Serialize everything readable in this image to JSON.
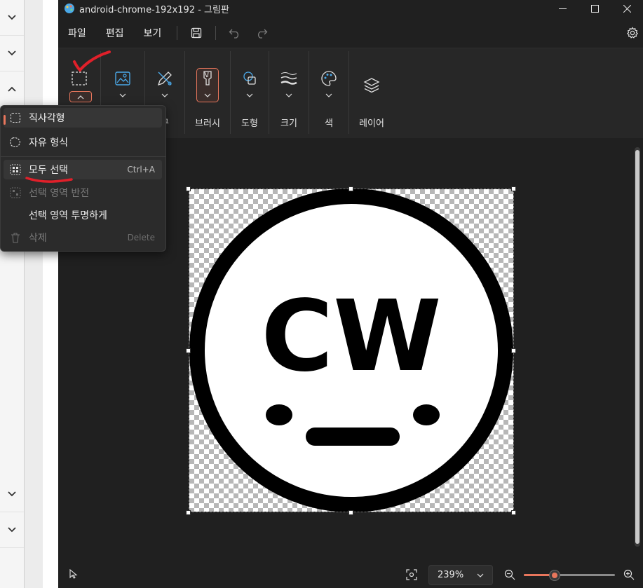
{
  "window": {
    "title": "android-chrome-192x192 - 그림판"
  },
  "menu": {
    "file": "파일",
    "edit": "편집",
    "view": "보기"
  },
  "toolbar": {
    "groups": [
      {
        "label": ""
      },
      {
        "label": ""
      },
      {
        "label": "구"
      },
      {
        "label": "브러시"
      },
      {
        "label": "도형"
      },
      {
        "label": "크기"
      },
      {
        "label": "색"
      },
      {
        "label": "레이어"
      }
    ]
  },
  "selection_menu": {
    "rectangle": "직사각형",
    "freeform": "자유 형식",
    "select_all": "모두 선택",
    "select_all_shortcut": "Ctrl+A",
    "invert": "선택 영역 반전",
    "transparent": "선택 영역 투명하게",
    "delete": "삭제",
    "delete_shortcut": "Delete"
  },
  "canvas": {
    "logo_text": "CW"
  },
  "status": {
    "zoom": "239%",
    "zoom_fraction": 0.33
  },
  "colors": {
    "accent": "#e8765c",
    "annotation": "#e0202a",
    "window_bg": "#202020"
  }
}
